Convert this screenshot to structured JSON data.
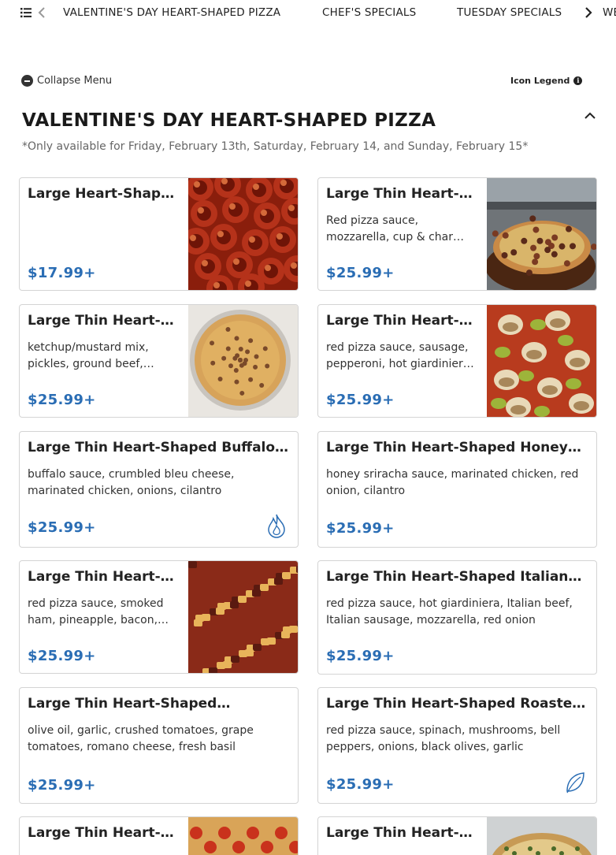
{
  "nav": {
    "categories": [
      "VALENTINE'S DAY HEART-SHAPED PIZZA",
      "CHEF'S SPECIALS",
      "TUESDAY SPECIALS",
      "WE"
    ]
  },
  "controls": {
    "collapse_label": "Collapse Menu",
    "legend_label": "Icon Legend"
  },
  "section": {
    "title": "VALENTINE'S DAY HEART-SHAPED PIZZA",
    "note": "*Only available for Friday, February 13th, Saturday, February 14, and Sunday, February 15*"
  },
  "items": [
    {
      "name": "Large Heart-Shap…",
      "desc": "",
      "price": "$17.99+",
      "image": "pepperoni-pizza",
      "badge": ""
    },
    {
      "name": "Large Thin Heart-…",
      "desc": "Red pizza sauce, mozzarella, cup & char…",
      "price": "$25.99+",
      "image": "pizza-on-board",
      "badge": ""
    },
    {
      "name": "Large Thin Heart-…",
      "desc": "ketchup/mustard mix, pickles, ground beef,…",
      "price": "$25.99+",
      "image": "cheeseburger-pizza",
      "badge": ""
    },
    {
      "name": "Large Thin Heart-…",
      "desc": "red pizza sauce, sausage, pepperoni, hot giardinier…",
      "price": "$25.99+",
      "image": "giardiniera-pizza",
      "badge": ""
    },
    {
      "name": "Large Thin Heart-Shaped Buffalo…",
      "desc": "buffalo sauce, crumbled bleu cheese, marinated chicken, onions, cilantro",
      "price": "$25.99+",
      "image": "",
      "badge": "spicy-flame-icon"
    },
    {
      "name": "Large Thin Heart-Shaped Honey…",
      "desc": "honey sriracha sauce, marinated chicken, red onion, cilantro",
      "price": "$25.99+",
      "image": "",
      "badge": ""
    },
    {
      "name": "Large Thin Heart-…",
      "desc": "red pizza sauce, smoked ham, pineapple, bacon,…",
      "price": "$25.99+",
      "image": "hawaiian-pizza",
      "badge": ""
    },
    {
      "name": "Large Thin Heart-Shaped Italian…",
      "desc": "red pizza sauce, hot giardiniera, Italian beef, Italian sausage, mozzarella, red onion",
      "price": "$25.99+",
      "image": "",
      "badge": ""
    },
    {
      "name": "Large Thin Heart-Shaped…",
      "desc": "olive oil, garlic, crushed tomatoes, grape tomatoes, romano cheese, fresh basil",
      "price": "$25.99+",
      "image": "",
      "badge": ""
    },
    {
      "name": "Large Thin Heart-Shaped Roaste…",
      "desc": "red pizza sauce, spinach, mushrooms, bell peppers, onions, black olives, garlic",
      "price": "$25.99+",
      "image": "",
      "badge": "vegetarian-leaf-icon"
    },
    {
      "name": "Large Thin Heart-…",
      "desc": "",
      "price": "",
      "image": "tomato-pizza",
      "badge": ""
    },
    {
      "name": "Large Thin Heart-…",
      "desc": "",
      "price": "",
      "image": "herb-pizza",
      "badge": ""
    }
  ],
  "colors": {
    "price": "#2a6db4",
    "border": "#d4d4d4",
    "text": "#222222"
  }
}
